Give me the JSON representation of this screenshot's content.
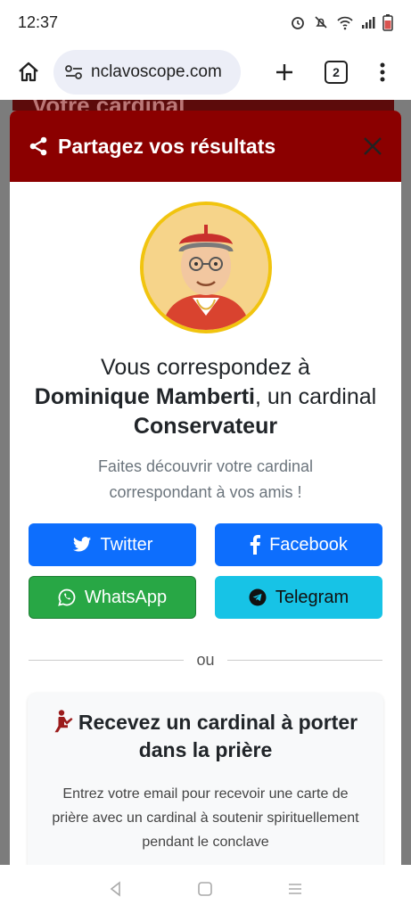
{
  "status_bar": {
    "time": "12:37"
  },
  "browser": {
    "url": "nclavoscope.com",
    "tab_count": "2"
  },
  "page": {
    "background_heading": "Votre cardinal"
  },
  "modal": {
    "title": "Partagez vos résultats",
    "headline_prefix": "Vous correspondez à",
    "cardinal_name": "Dominique Mamberti",
    "headline_middle": ", un cardinal ",
    "cardinal_type": "Conservateur",
    "subtitle": "Faites découvrir votre cardinal correspondant à vos amis !",
    "share_buttons": {
      "twitter": "Twitter",
      "facebook": "Facebook",
      "whatsapp": "WhatsApp",
      "telegram": "Telegram"
    },
    "divider_text": "ou",
    "prayer_card": {
      "title": "Recevez un cardinal à porter dans la prière",
      "text": "Entrez votre email pour recevoir une carte de prière avec un cardinal à soutenir spirituellement pendant le conclave"
    }
  },
  "colors": {
    "header": "#8b0000",
    "twitter": "#0d6efd",
    "whatsapp": "#28a745",
    "telegram": "#17c3e6"
  }
}
